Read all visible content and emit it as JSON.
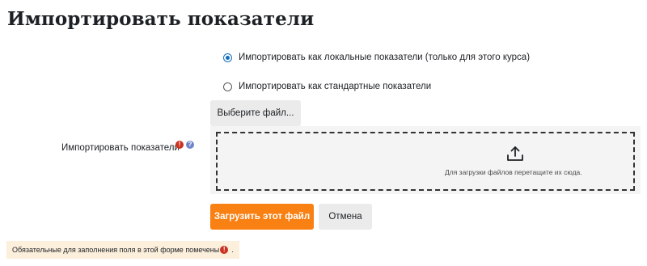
{
  "page": {
    "title": "Импортировать показатели"
  },
  "import_options": {
    "local": {
      "label": "Импортировать как локальные показатели (только для этого курса)",
      "selected": true
    },
    "standard": {
      "label": "Импортировать как стандартные показатели",
      "selected": false
    }
  },
  "file_field": {
    "label": "Импортировать показатели",
    "choose_button": "Выберите файл...",
    "required_icon": "!",
    "help_icon": "?",
    "dropzone_text": "Для загрузки файлов перетащите их сюда."
  },
  "actions": {
    "submit": "Загрузить этот файл",
    "cancel": "Отмена"
  },
  "footer": {
    "required_note": "Обязательные для заполнения поля в этой форме помечены",
    "required_note_end": "."
  },
  "colors": {
    "primary": "#f98012",
    "required": "#ca3120",
    "help": "#6f87c9",
    "radio": "#0f6cbf"
  },
  "icons": {
    "upload": "upload-icon",
    "required": "exclamation-icon",
    "help": "question-icon"
  }
}
